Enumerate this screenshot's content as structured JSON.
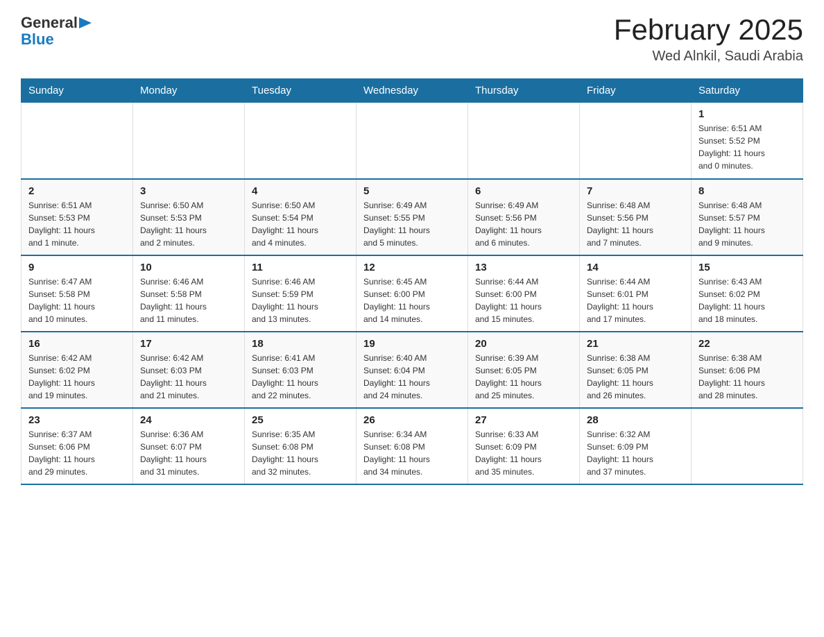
{
  "header": {
    "logo_general": "General",
    "logo_blue": "Blue",
    "title": "February 2025",
    "subtitle": "Wed Alnkil, Saudi Arabia"
  },
  "weekdays": [
    "Sunday",
    "Monday",
    "Tuesday",
    "Wednesday",
    "Thursday",
    "Friday",
    "Saturday"
  ],
  "weeks": [
    [
      {
        "day": "",
        "info": ""
      },
      {
        "day": "",
        "info": ""
      },
      {
        "day": "",
        "info": ""
      },
      {
        "day": "",
        "info": ""
      },
      {
        "day": "",
        "info": ""
      },
      {
        "day": "",
        "info": ""
      },
      {
        "day": "1",
        "info": "Sunrise: 6:51 AM\nSunset: 5:52 PM\nDaylight: 11 hours\nand 0 minutes."
      }
    ],
    [
      {
        "day": "2",
        "info": "Sunrise: 6:51 AM\nSunset: 5:53 PM\nDaylight: 11 hours\nand 1 minute."
      },
      {
        "day": "3",
        "info": "Sunrise: 6:50 AM\nSunset: 5:53 PM\nDaylight: 11 hours\nand 2 minutes."
      },
      {
        "day": "4",
        "info": "Sunrise: 6:50 AM\nSunset: 5:54 PM\nDaylight: 11 hours\nand 4 minutes."
      },
      {
        "day": "5",
        "info": "Sunrise: 6:49 AM\nSunset: 5:55 PM\nDaylight: 11 hours\nand 5 minutes."
      },
      {
        "day": "6",
        "info": "Sunrise: 6:49 AM\nSunset: 5:56 PM\nDaylight: 11 hours\nand 6 minutes."
      },
      {
        "day": "7",
        "info": "Sunrise: 6:48 AM\nSunset: 5:56 PM\nDaylight: 11 hours\nand 7 minutes."
      },
      {
        "day": "8",
        "info": "Sunrise: 6:48 AM\nSunset: 5:57 PM\nDaylight: 11 hours\nand 9 minutes."
      }
    ],
    [
      {
        "day": "9",
        "info": "Sunrise: 6:47 AM\nSunset: 5:58 PM\nDaylight: 11 hours\nand 10 minutes."
      },
      {
        "day": "10",
        "info": "Sunrise: 6:46 AM\nSunset: 5:58 PM\nDaylight: 11 hours\nand 11 minutes."
      },
      {
        "day": "11",
        "info": "Sunrise: 6:46 AM\nSunset: 5:59 PM\nDaylight: 11 hours\nand 13 minutes."
      },
      {
        "day": "12",
        "info": "Sunrise: 6:45 AM\nSunset: 6:00 PM\nDaylight: 11 hours\nand 14 minutes."
      },
      {
        "day": "13",
        "info": "Sunrise: 6:44 AM\nSunset: 6:00 PM\nDaylight: 11 hours\nand 15 minutes."
      },
      {
        "day": "14",
        "info": "Sunrise: 6:44 AM\nSunset: 6:01 PM\nDaylight: 11 hours\nand 17 minutes."
      },
      {
        "day": "15",
        "info": "Sunrise: 6:43 AM\nSunset: 6:02 PM\nDaylight: 11 hours\nand 18 minutes."
      }
    ],
    [
      {
        "day": "16",
        "info": "Sunrise: 6:42 AM\nSunset: 6:02 PM\nDaylight: 11 hours\nand 19 minutes."
      },
      {
        "day": "17",
        "info": "Sunrise: 6:42 AM\nSunset: 6:03 PM\nDaylight: 11 hours\nand 21 minutes."
      },
      {
        "day": "18",
        "info": "Sunrise: 6:41 AM\nSunset: 6:03 PM\nDaylight: 11 hours\nand 22 minutes."
      },
      {
        "day": "19",
        "info": "Sunrise: 6:40 AM\nSunset: 6:04 PM\nDaylight: 11 hours\nand 24 minutes."
      },
      {
        "day": "20",
        "info": "Sunrise: 6:39 AM\nSunset: 6:05 PM\nDaylight: 11 hours\nand 25 minutes."
      },
      {
        "day": "21",
        "info": "Sunrise: 6:38 AM\nSunset: 6:05 PM\nDaylight: 11 hours\nand 26 minutes."
      },
      {
        "day": "22",
        "info": "Sunrise: 6:38 AM\nSunset: 6:06 PM\nDaylight: 11 hours\nand 28 minutes."
      }
    ],
    [
      {
        "day": "23",
        "info": "Sunrise: 6:37 AM\nSunset: 6:06 PM\nDaylight: 11 hours\nand 29 minutes."
      },
      {
        "day": "24",
        "info": "Sunrise: 6:36 AM\nSunset: 6:07 PM\nDaylight: 11 hours\nand 31 minutes."
      },
      {
        "day": "25",
        "info": "Sunrise: 6:35 AM\nSunset: 6:08 PM\nDaylight: 11 hours\nand 32 minutes."
      },
      {
        "day": "26",
        "info": "Sunrise: 6:34 AM\nSunset: 6:08 PM\nDaylight: 11 hours\nand 34 minutes."
      },
      {
        "day": "27",
        "info": "Sunrise: 6:33 AM\nSunset: 6:09 PM\nDaylight: 11 hours\nand 35 minutes."
      },
      {
        "day": "28",
        "info": "Sunrise: 6:32 AM\nSunset: 6:09 PM\nDaylight: 11 hours\nand 37 minutes."
      },
      {
        "day": "",
        "info": ""
      }
    ]
  ]
}
